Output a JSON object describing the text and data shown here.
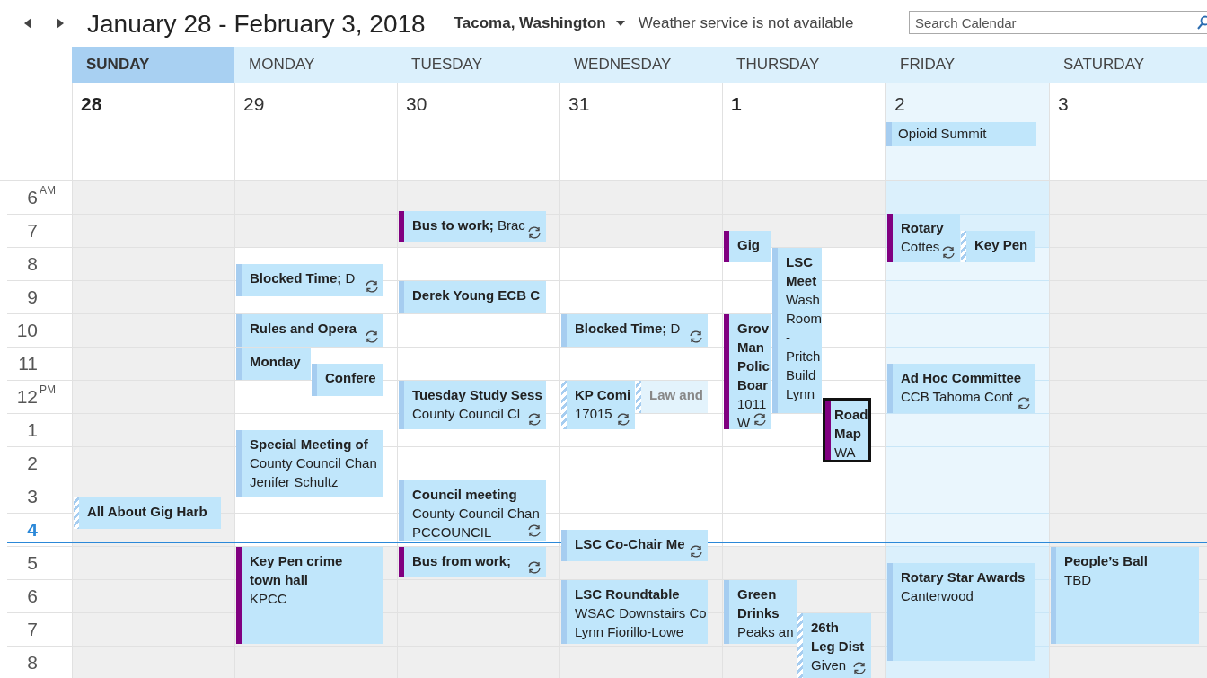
{
  "header": {
    "title": "January 28 - February 3, 2018",
    "location": "Tacoma, Washington",
    "weather": "Weather service is not available",
    "search": {
      "placeholder": "Search Calendar"
    }
  },
  "time_labels": [
    {
      "hour": "6",
      "suffix": "AM",
      "current": false
    },
    {
      "hour": "7",
      "current": false
    },
    {
      "hour": "8",
      "current": false
    },
    {
      "hour": "9",
      "current": false
    },
    {
      "hour": "10",
      "current": false
    },
    {
      "hour": "11",
      "current": false
    },
    {
      "hour": "12",
      "suffix": "PM",
      "current": false
    },
    {
      "hour": "1",
      "current": false
    },
    {
      "hour": "2",
      "current": false
    },
    {
      "hour": "3",
      "current": false
    },
    {
      "hour": "4",
      "current": true
    },
    {
      "hour": "5",
      "current": false
    },
    {
      "hour": "6",
      "current": false
    },
    {
      "hour": "7",
      "current": false
    },
    {
      "hour": "8",
      "current": false
    }
  ],
  "days": [
    {
      "name": "SUNDAY",
      "date": "28",
      "today": true,
      "date_bold": true,
      "selected": false,
      "workday": false,
      "events": [
        {
          "title_lines": [
            "All About Gig Harb"
          ],
          "kind": "tentative",
          "recurring": false,
          "selected": false
        }
      ]
    },
    {
      "name": "MONDAY",
      "date": "29",
      "today": false,
      "date_bold": false,
      "selected": false,
      "workday": true,
      "events": [
        {
          "title_lines": [
            "Blocked Time;"
          ],
          "detail_lines": [
            "D"
          ],
          "kind": "busy",
          "recurring": true,
          "selected": false
        },
        {
          "title_lines": [
            "Rules and Opera"
          ],
          "kind": "busy",
          "recurring": true,
          "selected": false
        },
        {
          "title_lines": [
            "Monday"
          ],
          "kind": "busy",
          "recurring": false,
          "selected": false
        },
        {
          "title_lines": [
            "Confere"
          ],
          "kind": "busy",
          "recurring": false,
          "selected": false
        },
        {
          "title_lines": [
            "Special Meeting of"
          ],
          "detail_lines": [
            "County Council Chan",
            "Jenifer Schultz"
          ],
          "kind": "busy",
          "recurring": false,
          "selected": false
        },
        {
          "title_lines": [
            "Key Pen crime",
            "town hall"
          ],
          "detail_lines": [
            "KPCC"
          ],
          "kind": "away",
          "recurring": false,
          "selected": false
        }
      ]
    },
    {
      "name": "TUESDAY",
      "date": "30",
      "today": false,
      "date_bold": false,
      "selected": false,
      "workday": true,
      "events": [
        {
          "title_lines": [
            "Bus to work;"
          ],
          "detail_lines": [
            "Brac"
          ],
          "kind": "away",
          "recurring": true,
          "selected": false
        },
        {
          "title_lines": [
            "Derek Young ECB C"
          ],
          "kind": "busy",
          "recurring": false,
          "selected": false
        },
        {
          "title_lines": [
            "Tuesday Study Sess"
          ],
          "detail_lines": [
            "County Council Cl"
          ],
          "kind": "busy",
          "recurring": true,
          "selected": false
        },
        {
          "title_lines": [
            "Council meeting"
          ],
          "detail_lines": [
            "County Council Chan",
            "PCCOUNCIL"
          ],
          "kind": "busy",
          "recurring": true,
          "selected": false
        },
        {
          "title_lines": [
            "Bus from work;"
          ],
          "kind": "away",
          "recurring": true,
          "selected": false
        }
      ]
    },
    {
      "name": "WEDNESDAY",
      "date": "31",
      "today": false,
      "date_bold": false,
      "selected": false,
      "workday": true,
      "events": [
        {
          "title_lines": [
            "Blocked Time;"
          ],
          "detail_lines": [
            "D"
          ],
          "kind": "busy",
          "recurring": true,
          "selected": false
        },
        {
          "title_lines": [
            "KP Comi"
          ],
          "detail_lines": [
            "17015"
          ],
          "kind": "tentative",
          "recurring": true,
          "selected": false
        },
        {
          "title_lines": [
            "Law and"
          ],
          "kind": "free",
          "recurring": false,
          "selected": false
        },
        {
          "title_lines": [
            "LSC Co-Chair Me"
          ],
          "kind": "busy",
          "recurring": true,
          "selected": false
        },
        {
          "title_lines": [
            "LSC Roundtable"
          ],
          "detail_lines": [
            "WSAC Downstairs Co",
            "Lynn Fiorillo-Lowe"
          ],
          "kind": "busy",
          "recurring": false,
          "selected": false
        }
      ]
    },
    {
      "name": "THURSDAY",
      "date": "1",
      "today": false,
      "date_bold": true,
      "selected": false,
      "workday": true,
      "events": [
        {
          "title_lines": [
            "Gig"
          ],
          "kind": "away",
          "recurring": false,
          "selected": false
        },
        {
          "title_lines": [
            "LSC",
            "Meet"
          ],
          "detail_lines": [
            "Wash",
            "Room",
            "-",
            "Pritch",
            "Build",
            "Lynn"
          ],
          "kind": "busy",
          "recurring": false,
          "selected": false
        },
        {
          "title_lines": [
            "Grov",
            "Man",
            "Polic",
            "Boar"
          ],
          "detail_lines": [
            "1011",
            "W"
          ],
          "kind": "away",
          "recurring": true,
          "selected": false
        },
        {
          "title_lines": [
            "Road",
            "Map"
          ],
          "detail_lines": [
            "WA"
          ],
          "kind": "away",
          "recurring": false,
          "selected": true
        },
        {
          "title_lines": [
            "Green",
            "Drinks"
          ],
          "detail_lines": [
            "Peaks an"
          ],
          "kind": "busy",
          "recurring": false,
          "selected": false
        },
        {
          "title_lines": [
            "26th",
            "Leg Dist"
          ],
          "detail_lines": [
            "Given"
          ],
          "kind": "tentative",
          "recurring": true,
          "selected": false
        }
      ]
    },
    {
      "name": "FRIDAY",
      "date": "2",
      "today": false,
      "date_bold": false,
      "selected": true,
      "workday": true,
      "all_day": [
        {
          "title": "Opioid Summit",
          "kind": "busy"
        }
      ],
      "events": [
        {
          "title_lines": [
            "Rotary"
          ],
          "detail_lines": [
            "Cottes"
          ],
          "kind": "away",
          "recurring": true,
          "selected": false
        },
        {
          "title_lines": [
            "Key Pen"
          ],
          "kind": "tentative",
          "recurring": false,
          "selected": false
        },
        {
          "title_lines": [
            "Ad Hoc Committee"
          ],
          "detail_lines": [
            "CCB Tahoma Conf"
          ],
          "kind": "busy",
          "recurring": true,
          "selected": false
        },
        {
          "title_lines": [
            "Rotary Star Awards"
          ],
          "detail_lines": [
            "Canterwood"
          ],
          "kind": "busy",
          "recurring": false,
          "selected": false
        }
      ]
    },
    {
      "name": "SATURDAY",
      "date": "3",
      "today": false,
      "date_bold": false,
      "selected": false,
      "workday": false,
      "events": [
        {
          "title_lines": [
            "People’s Ball"
          ],
          "detail_lines": [
            "TBD"
          ],
          "kind": "busy",
          "recurring": false,
          "selected": false
        }
      ]
    }
  ]
}
